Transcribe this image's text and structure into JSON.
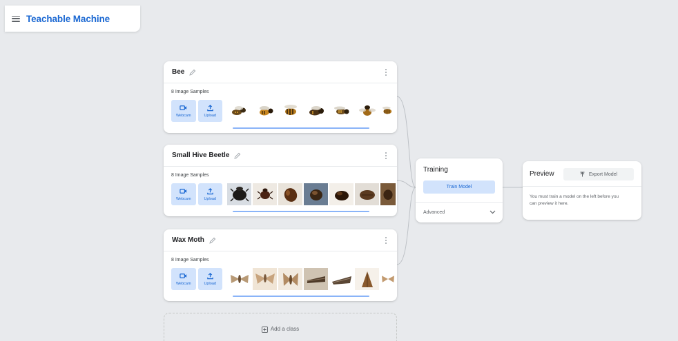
{
  "app": {
    "title": "Teachable Machine",
    "menu_icon": "hamburger-menu-icon",
    "brand_color": "#1967d2"
  },
  "classes": [
    {
      "name": "Bee",
      "samples_label": "8 Image Samples",
      "webcam_label": "Webcam",
      "upload_label": "Upload",
      "thumb_kind": "bee"
    },
    {
      "name": "Small Hive Beetle",
      "samples_label": "8 Image Samples",
      "webcam_label": "Webcam",
      "upload_label": "Upload",
      "thumb_kind": "beetle"
    },
    {
      "name": "Wax Moth",
      "samples_label": "8 Image Samples",
      "webcam_label": "Webcam",
      "upload_label": "Upload",
      "thumb_kind": "moth"
    }
  ],
  "training": {
    "title": "Training",
    "train_button": "Train Model",
    "advanced_label": "Advanced"
  },
  "preview": {
    "title": "Preview",
    "export_button": "Export Model",
    "message": "You must train a model on the left before you can preview it here."
  },
  "add_class": {
    "label": "Add a class"
  },
  "colors": {
    "accent": "#1967d2",
    "accent_light": "#d2e3fc",
    "scroll": "#8ab4f8",
    "background": "#e8eaed"
  }
}
